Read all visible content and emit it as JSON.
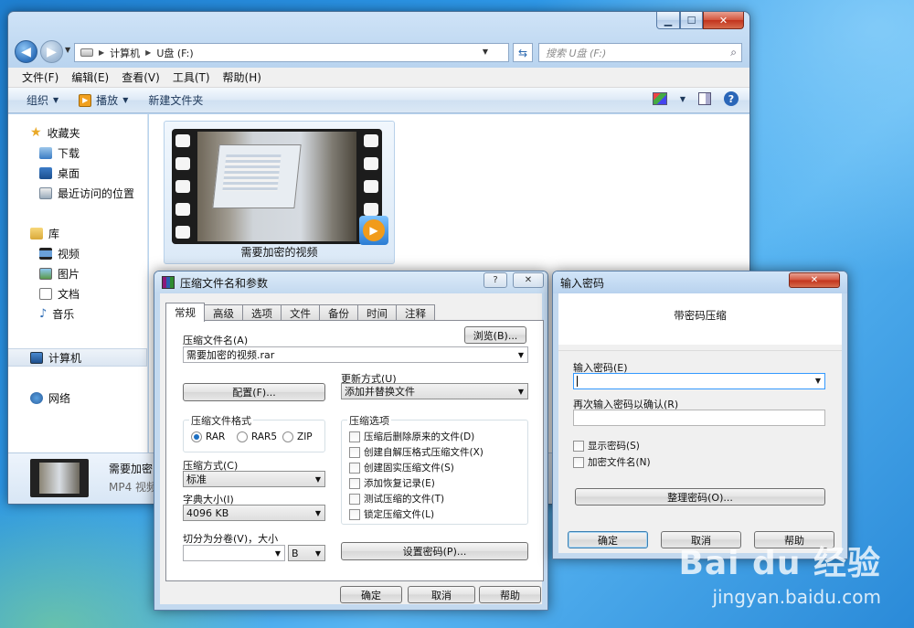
{
  "explorer": {
    "window_controls": {
      "minimize": "▁",
      "maximize": "☐",
      "close": "✕"
    },
    "address": {
      "root": "计算机",
      "drive": "U盘 (F:)"
    },
    "search_placeholder": "搜索 U盘 (F:)",
    "menu": [
      "文件(F)",
      "编辑(E)",
      "查看(V)",
      "工具(T)",
      "帮助(H)"
    ],
    "toolbar": {
      "organize": "组织",
      "play": "播放",
      "new_folder": "新建文件夹"
    },
    "nav": {
      "favorites": "收藏夹",
      "downloads": "下载",
      "desktop": "桌面",
      "recent": "最近访问的位置",
      "libraries": "库",
      "videos": "视频",
      "pictures": "图片",
      "documents": "文档",
      "music": "音乐",
      "computer": "计算机",
      "network": "网络"
    },
    "file": {
      "name": "需要加密的视频"
    },
    "details": {
      "name": "需要加密",
      "type": "MP4 视频"
    }
  },
  "archive_dialog": {
    "title": "压缩文件名和参数",
    "help_btn": "?",
    "close_btn": "✕",
    "tabs": [
      "常规",
      "高级",
      "选项",
      "文件",
      "备份",
      "时间",
      "注释"
    ],
    "archive_name_label": "压缩文件名(A)",
    "browse": "浏览(B)...",
    "archive_name_value": "需要加密的视频.rar",
    "profiles": "配置(F)...",
    "update_mode_label": "更新方式(U)",
    "update_mode_value": "添加并替换文件",
    "format_group": "压缩文件格式",
    "formats": [
      "RAR",
      "RAR5",
      "ZIP"
    ],
    "options_group": "压缩选项",
    "options": [
      "压缩后删除原来的文件(D)",
      "创建自解压格式压缩文件(X)",
      "创建固实压缩文件(S)",
      "添加恢复记录(E)",
      "测试压缩的文件(T)",
      "锁定压缩文件(L)"
    ],
    "method_label": "压缩方式(C)",
    "method_value": "标准",
    "dict_label": "字典大小(I)",
    "dict_value": "4096 KB",
    "split_label": "切分为分卷(V)，大小",
    "split_unit": "B",
    "set_password": "设置密码(P)...",
    "ok": "确定",
    "cancel": "取消",
    "help": "帮助"
  },
  "password_dialog": {
    "title": "输入密码",
    "close_btn": "✕",
    "header": "带密码压缩",
    "enter_label": "输入密码(E)",
    "reenter_label": "再次输入密码以确认(R)",
    "show_password": "显示密码(S)",
    "encrypt_names": "加密文件名(N)",
    "organize": "整理密码(O)...",
    "ok": "确定",
    "cancel": "取消",
    "help": "帮助"
  },
  "watermark": {
    "brand": "Bai du 经验",
    "url": "jingyan.baidu.com"
  }
}
